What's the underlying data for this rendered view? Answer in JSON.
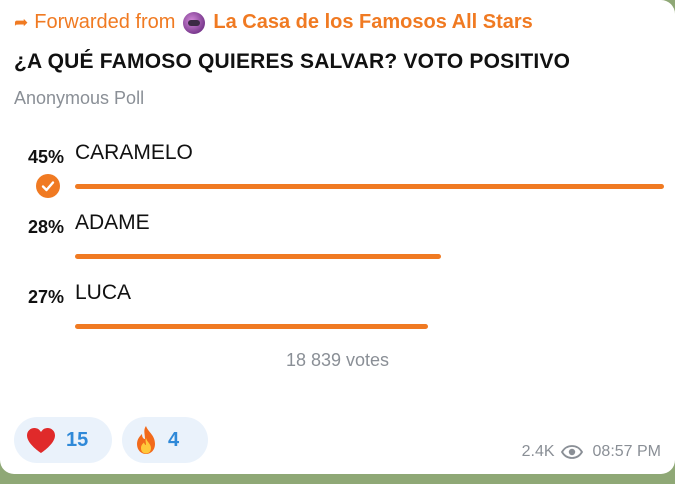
{
  "message": {
    "forwarded_label": "Forwarded from",
    "channel_name": "La Casa de los Famosos All Stars",
    "forward_icon": "forward-arrow-icon",
    "channel_avatar": "channel-avatar"
  },
  "poll": {
    "question": "¿A QUÉ FAMOSO QUIERES SALVAR? VOTO POSITIVO",
    "type": "Anonymous Poll",
    "options": [
      {
        "percent_label": "45%",
        "label": "CARAMELO",
        "fraction": 0.45,
        "chosen": true
      },
      {
        "percent_label": "28%",
        "label": "ADAME",
        "fraction": 0.28,
        "chosen": false
      },
      {
        "percent_label": "27%",
        "label": "LUCA",
        "fraction": 0.27,
        "chosen": false
      }
    ],
    "total_votes": "18 839 votes"
  },
  "reactions": [
    {
      "icon": "heart-icon",
      "count": "15"
    },
    {
      "icon": "fire-icon",
      "count": "4"
    }
  ],
  "footer": {
    "views": "2.4K",
    "views_icon": "eye-icon",
    "time": "08:57 PM"
  },
  "colors": {
    "accent": "#f07a22",
    "reaction_text": "#2f89d8",
    "reaction_bg": "#eaf2fb",
    "muted": "#8a8f96",
    "chat_background": "#8fa876"
  }
}
